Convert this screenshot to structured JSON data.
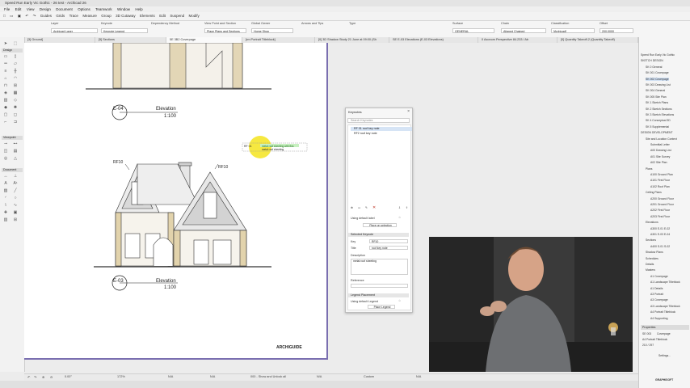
{
  "window": {
    "title": "Speed Run Early Vic Gothic - 26 test - Archicad 26"
  },
  "menu": [
    "File",
    "Edit",
    "View",
    "Design",
    "Document",
    "Options",
    "Teamwork",
    "Window",
    "Help"
  ],
  "toolbar": {
    "items": [
      "Guides",
      "Grids",
      "Trace",
      "Measure",
      "Group",
      "Elements",
      "Edit",
      "Suspend",
      "Modify"
    ],
    "cutaway_label": "3D Cutaway"
  },
  "infobox": {
    "layer_label": "Layer",
    "layer_value": "Archicad Layer",
    "keynote_label": "Keynote",
    "keynote_value": "Keynote Legend",
    "dependency_label": "Dependency Method",
    "view_label": "View Point and Section",
    "place_label": "Place Plans and Sections",
    "owner_label": "Global Owner",
    "owner_value": "Home Shop",
    "arrow_label": "Arrows and Tips",
    "type_label": "Type",
    "surface_label": "Surface",
    "surface_value": "GENERAL",
    "chain_label": "Chain",
    "chain_value": "Aligned Chained",
    "classification_label": "Classification",
    "classification_value": "[Archicad]",
    "offset_label": "Offset",
    "offset_value": "200.0000"
  },
  "tabs": [
    "[3] Ground]",
    "[5] Sections",
    "5E 3B2 Coverpage",
    "[rm Portrait Titleblock]",
    "[0] 3D Shadow Study 21 June at 09:00 (Sh",
    "SE E-03 Elevations (E-03 Elevations)",
    "0 Axonom Perspective 84.233 / Ab",
    "[0] Quantity Takeoff-2 (Quantity Takeoff)"
  ],
  "toolbox": {
    "arrow_label": "Arrow",
    "sections": [
      "Design",
      "Viewpoint",
      "Document"
    ]
  },
  "drawing": {
    "elevation_top_tag": "E-04",
    "elevation_top_title": "Elevation",
    "elevation_top_scale": "1:100",
    "elevation_bottom_tag": "E-03",
    "elevation_bottom_title": "Elevation",
    "elevation_bottom_scale": "1:100",
    "roof_tag_left": "RF10",
    "roof_tag_right": "RF10",
    "callout_id": "RF 01",
    "callout_text_line1": "metal roof sheeting with fins",
    "callout_text_line2": "metal roof sheeting",
    "logo": "ARCHIGUIDE"
  },
  "keynotes": {
    "title": "Keynotes",
    "search_placeholder": "Search Keynotes",
    "items": [
      "RF 01 roof key note",
      "RF2 roof key note"
    ],
    "using_default_label": "Using default label",
    "place_selection_button": "Place on selection",
    "selected_section": "Selected Keynote",
    "key_label": "Key",
    "key_value": "RF10",
    "title_label": "Title",
    "title_value": "roof key note",
    "description_label": "Description",
    "description_value": "metal roof sheeting",
    "reference_label": "Reference",
    "legend_section": "Legend Placement",
    "legend_default": "Using default Legend",
    "place_legend_button": "Place Legend"
  },
  "navigator": {
    "items": [
      "Speed Run Early Vic Gothic",
      "SKETCH DESIGN",
      "SK 0 General",
      "SK 001 Coverpage",
      "SK 002 Coverpage",
      "SK 003 Drawing List",
      "SK 004 General",
      "SK 005 Site Plan",
      "SK 1 Sketch Plans",
      "SK 2 Sketch Sections",
      "SK 3 Sketch Elevations",
      "SK 4 Conceptual 3D",
      "SK 5 Supplemental",
      "DESIGN DEVELOPMENT",
      "Site and Location Context",
      "Submittal Letter",
      "A00 Drawing List",
      "A01 Site Survey",
      "A02 Site Plan",
      "Plans",
      "A100 Ground Plan",
      "A101 First Floor",
      "A102 Roof Plan",
      "Ceiling Plans",
      "A200 Ground Floor",
      "A201 Ground Floor",
      "A202 First Floor",
      "A203 First Floor",
      "Elevations",
      "A300 E-01 E-02",
      "A301 E-03 E-04",
      "Sections",
      "A400 S-01 S-02",
      "Shadow Plans",
      "Schedules",
      "Details",
      "Masters",
      "A1 Coverpage",
      "A1 Landscape Titleblock",
      "A1 Details",
      "A3 Portrait",
      "A3 Coverpage",
      "A3 Landscape Titleblock",
      "A4 Portrait Titleblock",
      "A4 Supporting"
    ],
    "selected_index": 4,
    "properties_label": "Properties",
    "prop_id": "SE 003",
    "prop_name": "Coverpage",
    "prop_master": "A4 Portrait Titleblock",
    "prop_size": "210 / 297",
    "settings_label": "Settings..."
  },
  "statusbar": {
    "zoom": "172%",
    "angle": "0.00°",
    "view": "000 - Show and Unlock all",
    "custom": "Custom",
    "na1": "N/A",
    "na2": "N/A",
    "na3": "N/A",
    "na4": "N/A",
    "graphisoft": "GRAPHISOFT"
  },
  "colors": {
    "accent": "#7a6fb0",
    "highlight": "#f5e41f",
    "selection": "#d6e4f5"
  }
}
